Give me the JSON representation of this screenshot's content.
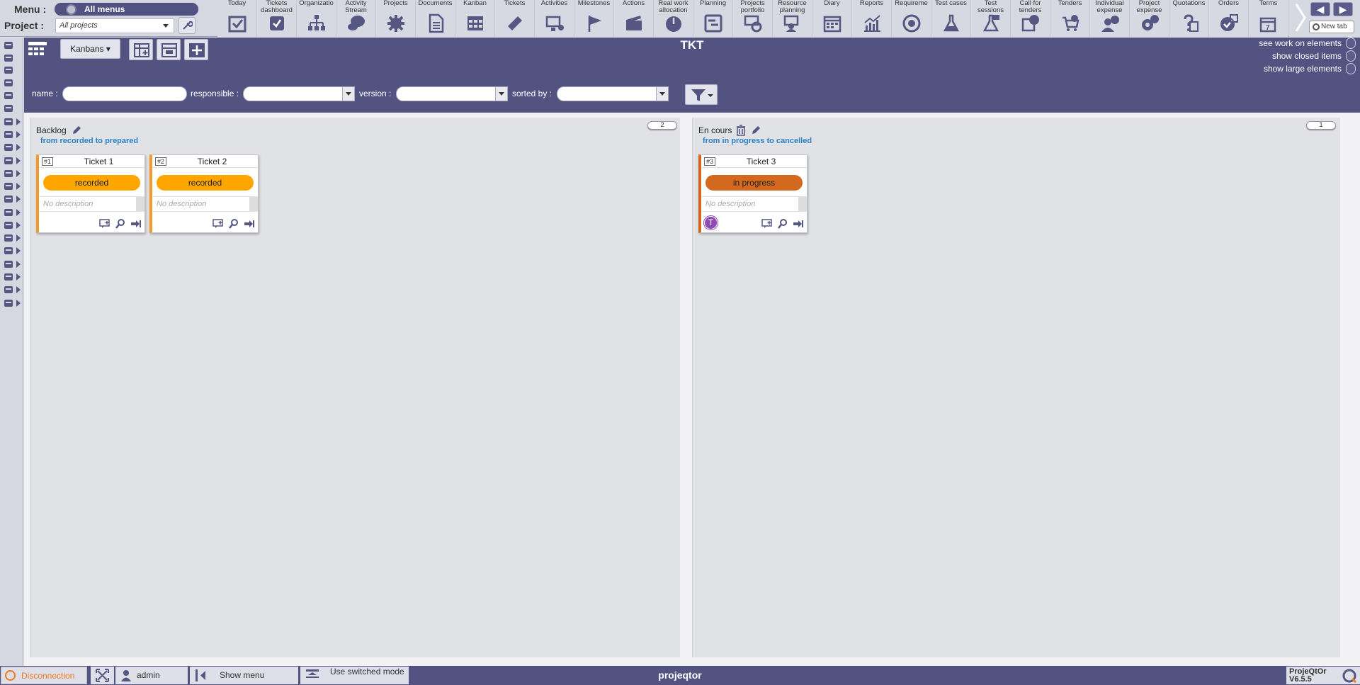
{
  "top": {
    "menu_label": "Menu :",
    "menu_value": "All menus",
    "project_label": "Project :",
    "project_value": "All projects",
    "toolbar": [
      {
        "label": "Today",
        "icon": "today-icon"
      },
      {
        "label": "Tickets dashboard",
        "icon": "tickets-dashboard-icon"
      },
      {
        "label": "Organizatio",
        "icon": "organization-icon"
      },
      {
        "label": "Activity Stream",
        "icon": "activity-stream-icon"
      },
      {
        "label": "Projects",
        "icon": "projects-icon"
      },
      {
        "label": "Documents",
        "icon": "documents-icon"
      },
      {
        "label": "Kanban",
        "icon": "kanban-icon"
      },
      {
        "label": "Tickets",
        "icon": "tickets-icon"
      },
      {
        "label": "Activities",
        "icon": "activities-icon"
      },
      {
        "label": "Milestones",
        "icon": "milestones-icon"
      },
      {
        "label": "Actions",
        "icon": "actions-icon"
      },
      {
        "label": "Real work allocation",
        "icon": "real-work-icon"
      },
      {
        "label": "Planning",
        "icon": "planning-icon"
      },
      {
        "label": "Projects portfolio",
        "icon": "portfolio-icon"
      },
      {
        "label": "Resource planning",
        "icon": "resource-planning-icon"
      },
      {
        "label": "Diary",
        "icon": "diary-icon"
      },
      {
        "label": "Reports",
        "icon": "reports-icon"
      },
      {
        "label": "Requireme",
        "icon": "requirements-icon"
      },
      {
        "label": "Test cases",
        "icon": "test-cases-icon"
      },
      {
        "label": "Test sessions",
        "icon": "test-sessions-icon"
      },
      {
        "label": "Call for tenders",
        "icon": "call-for-tenders-icon"
      },
      {
        "label": "Tenders",
        "icon": "tenders-icon"
      },
      {
        "label": "Individual expense",
        "icon": "individual-expense-icon"
      },
      {
        "label": "Project expense",
        "icon": "project-expense-icon"
      },
      {
        "label": "Quotations",
        "icon": "quotations-icon"
      },
      {
        "label": "Orders",
        "icon": "orders-icon"
      },
      {
        "label": "Terms",
        "icon": "terms-icon"
      }
    ],
    "new_tab": "New tab"
  },
  "header": {
    "title": "TKT",
    "kanbans_label": "Kanbans",
    "toggles": [
      "see work on elements",
      "show closed items",
      "show large elements"
    ],
    "filters": {
      "name_label": "name :",
      "responsible_label": "responsible :",
      "version_label": "version :",
      "sorted_label": "sorted by :"
    }
  },
  "columns": [
    {
      "title": "Backlog",
      "subtitle": "from recorded to prepared",
      "count": "2",
      "cards": [
        {
          "id": "#1",
          "name": "Ticket 1",
          "status": "recorded",
          "status_color": "#ffa500",
          "description": "No description"
        },
        {
          "id": "#2",
          "name": "Ticket 2",
          "status": "recorded",
          "status_color": "#ffa500",
          "description": "No description"
        }
      ]
    },
    {
      "title": "En cours",
      "subtitle": "from in progress to cancelled",
      "count": "1",
      "cards": [
        {
          "id": "#3",
          "name": "Ticket 3",
          "status": "in progress",
          "status_color": "#d2691e",
          "description": "No description",
          "avatar": "T"
        }
      ]
    }
  ],
  "bottom": {
    "disconnect": "Disconnection",
    "user": "admin",
    "show_menu": "Show menu",
    "switched_mode": "Use switched mode",
    "app_name": "projeqtor",
    "version_line1": "ProjeQtOr",
    "version_line2": "V6.5.5"
  },
  "colors": {
    "primary": "#535382",
    "accent": "#f07b1f"
  }
}
